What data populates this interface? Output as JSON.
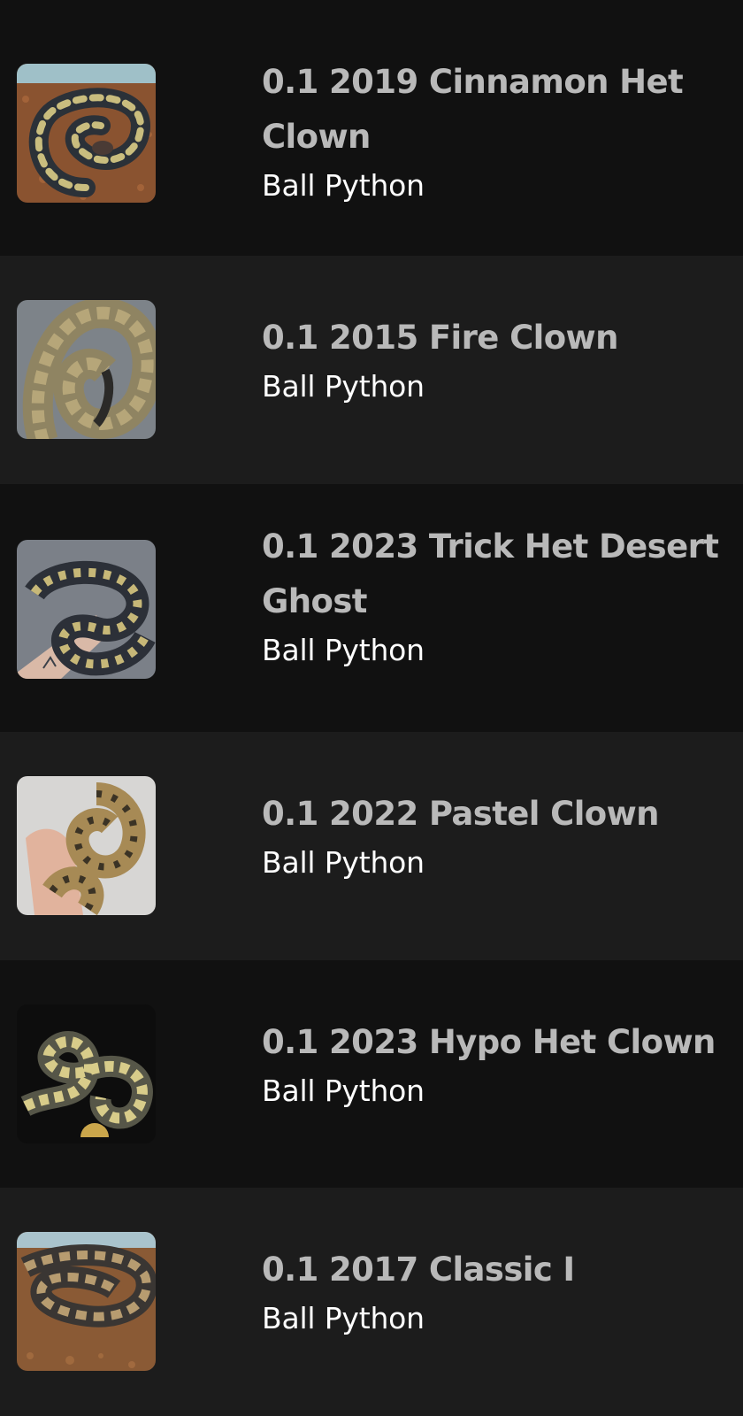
{
  "listings": [
    {
      "title": "0.1 2019 Cinnamon Het Clown",
      "species": "Ball Python",
      "photo": "ball-python-photo"
    },
    {
      "title": "0.1 2015 Fire Clown",
      "species": "Ball Python",
      "photo": "ball-python-photo"
    },
    {
      "title": "0.1 2023 Trick Het Desert Ghost",
      "species": "Ball Python",
      "photo": "ball-python-photo"
    },
    {
      "title": "0.1 2022 Pastel Clown",
      "species": "Ball Python",
      "photo": "ball-python-photo"
    },
    {
      "title": "0.1 2023 Hypo Het Clown",
      "species": "Ball Python",
      "photo": "ball-python-photo"
    },
    {
      "title": "0.1 2017 Classic I",
      "species": "Ball Python",
      "photo": "ball-python-photo"
    }
  ],
  "colors": {
    "row_dark": "#111111",
    "row_light": "#1c1c1c",
    "title": "#b9b9b9",
    "subtitle": "#ffffff"
  }
}
